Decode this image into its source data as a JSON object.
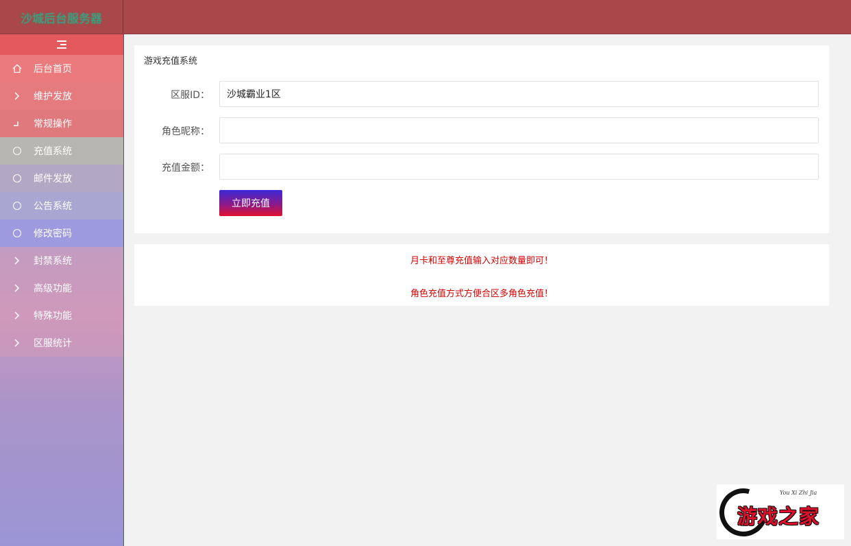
{
  "header": {
    "logo": "沙城后台服务器"
  },
  "sidebar": {
    "toggle_icon": "menu-fold-icon",
    "items": [
      {
        "label": "后台首页",
        "icon": "home-icon"
      },
      {
        "label": "维护发放",
        "icon": "chevron-right-icon"
      },
      {
        "label": "常规操作",
        "icon": "collapse-icon"
      },
      {
        "label": "充值系统",
        "icon": "circle-icon"
      },
      {
        "label": "邮件发放",
        "icon": "circle-icon"
      },
      {
        "label": "公告系统",
        "icon": "circle-icon"
      },
      {
        "label": "修改密码",
        "icon": "circle-icon"
      },
      {
        "label": "封禁系统",
        "icon": "chevron-right-icon"
      },
      {
        "label": "高级功能",
        "icon": "chevron-right-icon"
      },
      {
        "label": "特殊功能",
        "icon": "chevron-right-icon"
      },
      {
        "label": "区服统计",
        "icon": "chevron-right-icon"
      }
    ]
  },
  "form": {
    "title": "游戏充值系统",
    "server_label": "区服ID：",
    "server_value": "沙城霸业1区",
    "role_label": "角色昵称：",
    "role_value": "",
    "amount_label": "充值金额：",
    "amount_value": "",
    "submit_label": "立即充值"
  },
  "notes": {
    "line1": "月卡和至尊充值输入对应数量即可！",
    "line2": "角色充值方式方便合区多角色充值！"
  },
  "watermark": {
    "script": "You Xi Zhi Jia",
    "text": "游戏之家"
  },
  "colors": {
    "header": "#a9474b",
    "note_text": "#d40000",
    "button_top": "#3c28d8",
    "button_bottom": "#e0102c"
  }
}
